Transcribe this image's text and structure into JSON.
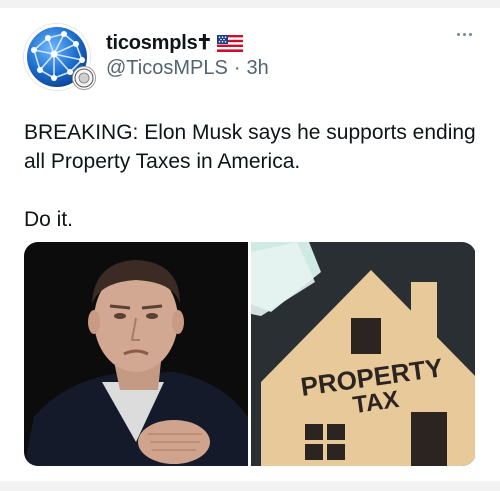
{
  "tweet": {
    "author": {
      "display_name": "ticosmpls",
      "cross": "✝",
      "flag_icon": "us-flag-icon",
      "handle": "@TicosMPLS",
      "separator": "·",
      "time": "3h"
    },
    "text_lines": [
      "BREAKING: Elon Musk says he supports ending all Property Taxes in America.",
      "Do it."
    ],
    "media": {
      "photo_1": "elon-musk-photo",
      "photo_2": "property-tax-house-photo",
      "sign_line_1": "PROPERTY",
      "sign_line_2": "TAX"
    }
  },
  "colors": {
    "text": "#0f1419",
    "secondary": "#536471",
    "avatar_blue": "#1e6fd0",
    "wood": "#e8c99a"
  }
}
